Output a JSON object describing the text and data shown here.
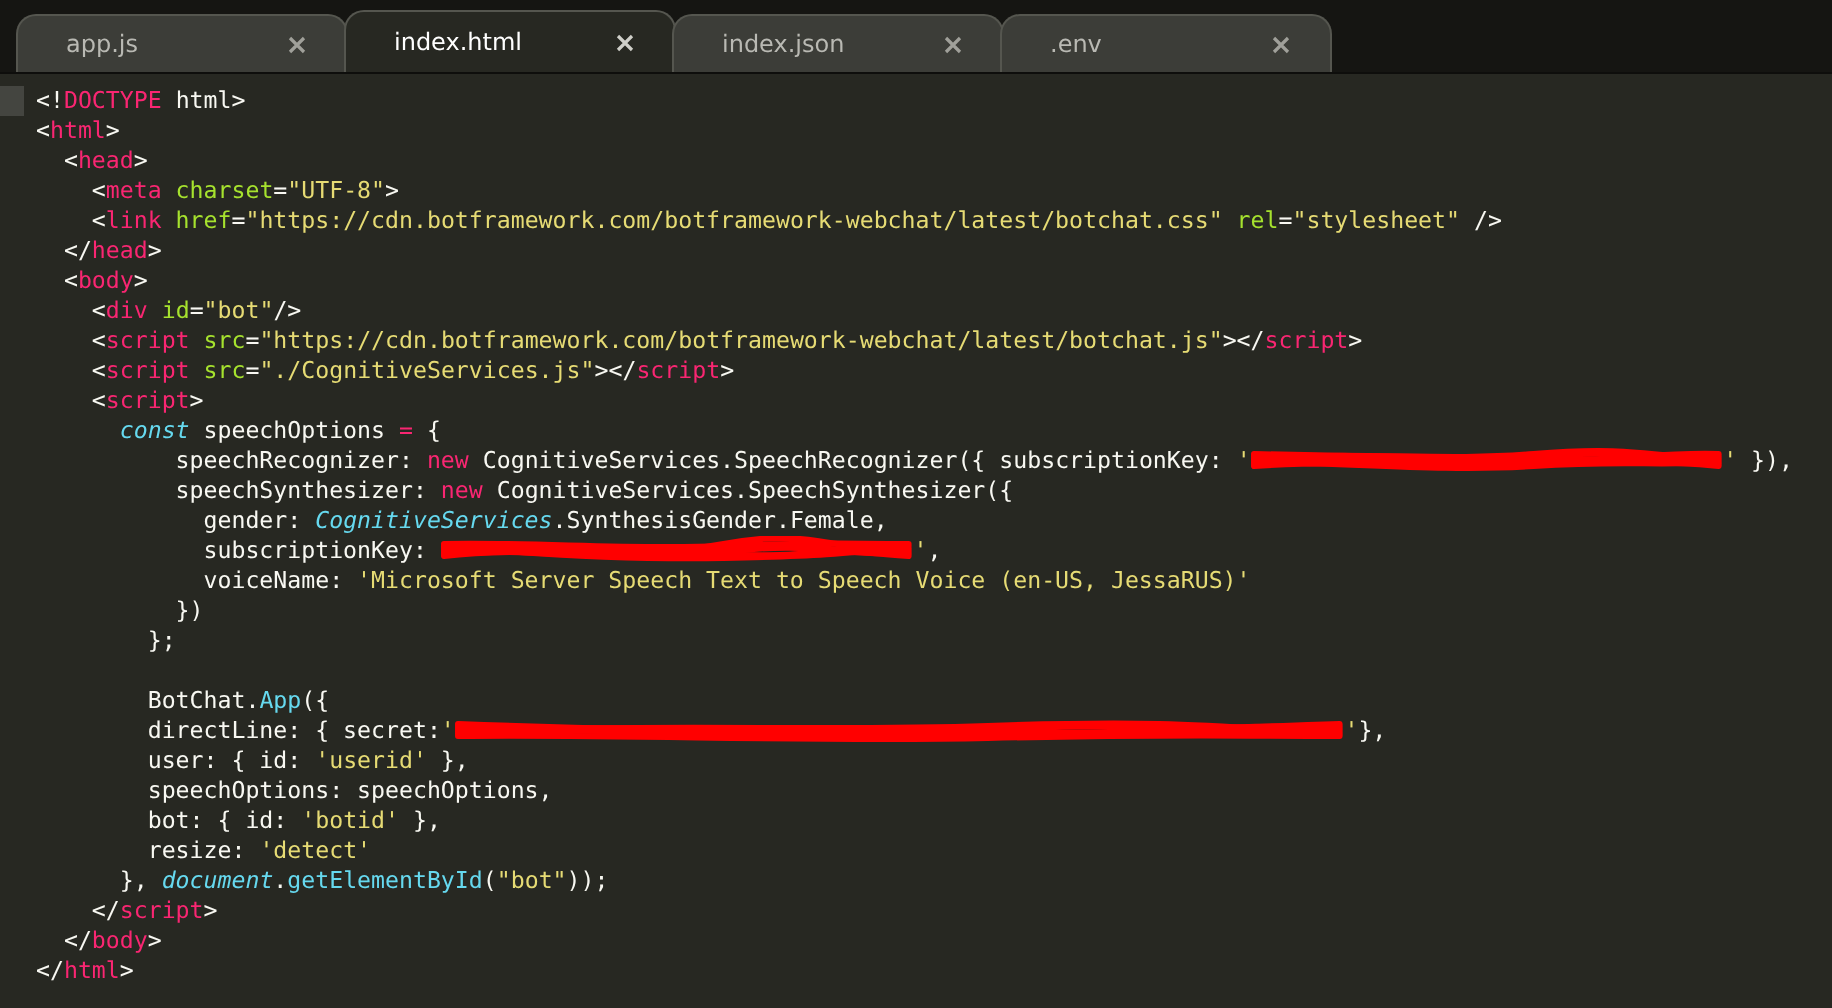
{
  "tabs": [
    {
      "label": "app.js",
      "selected": false
    },
    {
      "label": "index.html",
      "selected": true
    },
    {
      "label": "index.json",
      "selected": false
    },
    {
      "label": ".env",
      "selected": false
    }
  ],
  "editor": {
    "lines": [
      [
        {
          "kind": "p",
          "text": "<!"
        },
        {
          "kind": "tag",
          "text": "DOCTYPE"
        },
        {
          "kind": "p",
          "text": " html>"
        }
      ],
      [
        {
          "kind": "p",
          "text": "<"
        },
        {
          "kind": "tag",
          "text": "html"
        },
        {
          "kind": "p",
          "text": ">"
        }
      ],
      [
        {
          "kind": "p",
          "text": "  <"
        },
        {
          "kind": "tag",
          "text": "head"
        },
        {
          "kind": "p",
          "text": ">"
        }
      ],
      [
        {
          "kind": "p",
          "text": "    <"
        },
        {
          "kind": "tag",
          "text": "meta"
        },
        {
          "kind": "attr",
          "text": " charset"
        },
        {
          "kind": "p",
          "text": "="
        },
        {
          "kind": "str",
          "text": "\"UTF-8\""
        },
        {
          "kind": "p",
          "text": ">"
        }
      ],
      [
        {
          "kind": "p",
          "text": "    <"
        },
        {
          "kind": "tag",
          "text": "link"
        },
        {
          "kind": "attr",
          "text": " href"
        },
        {
          "kind": "p",
          "text": "="
        },
        {
          "kind": "str",
          "text": "\"https://cdn.botframework.com/botframework-webchat/latest/botchat.css\""
        },
        {
          "kind": "attr",
          "text": " rel"
        },
        {
          "kind": "p",
          "text": "="
        },
        {
          "kind": "str",
          "text": "\"stylesheet\""
        },
        {
          "kind": "p",
          "text": " />"
        }
      ],
      [
        {
          "kind": "p",
          "text": "  </"
        },
        {
          "kind": "tag",
          "text": "head"
        },
        {
          "kind": "p",
          "text": ">"
        }
      ],
      [
        {
          "kind": "p",
          "text": "  <"
        },
        {
          "kind": "tag",
          "text": "body"
        },
        {
          "kind": "p",
          "text": ">"
        }
      ],
      [
        {
          "kind": "p",
          "text": "    <"
        },
        {
          "kind": "tag",
          "text": "div"
        },
        {
          "kind": "attr",
          "text": " id"
        },
        {
          "kind": "p",
          "text": "="
        },
        {
          "kind": "str",
          "text": "\"bot\""
        },
        {
          "kind": "p",
          "text": "/>"
        }
      ],
      [
        {
          "kind": "p",
          "text": "    <"
        },
        {
          "kind": "tag",
          "text": "script"
        },
        {
          "kind": "attr",
          "text": " src"
        },
        {
          "kind": "p",
          "text": "="
        },
        {
          "kind": "str",
          "text": "\"https://cdn.botframework.com/botframework-webchat/latest/botchat.js\""
        },
        {
          "kind": "p",
          "text": "></"
        },
        {
          "kind": "tag",
          "text": "script"
        },
        {
          "kind": "p",
          "text": ">"
        }
      ],
      [
        {
          "kind": "p",
          "text": "    <"
        },
        {
          "kind": "tag",
          "text": "script"
        },
        {
          "kind": "attr",
          "text": " src"
        },
        {
          "kind": "p",
          "text": "="
        },
        {
          "kind": "str",
          "text": "\"./CognitiveServices.js\""
        },
        {
          "kind": "p",
          "text": "></"
        },
        {
          "kind": "tag",
          "text": "script"
        },
        {
          "kind": "p",
          "text": ">"
        }
      ],
      [
        {
          "kind": "p",
          "text": "    <"
        },
        {
          "kind": "tag",
          "text": "script"
        },
        {
          "kind": "p",
          "text": ">"
        }
      ],
      [
        {
          "kind": "st",
          "text": "      const"
        },
        {
          "kind": "p",
          "text": " speechOptions "
        },
        {
          "kind": "kw",
          "text": "="
        },
        {
          "kind": "p",
          "text": " {"
        }
      ],
      [
        {
          "kind": "p",
          "text": "          speechRecognizer: "
        },
        {
          "kind": "kw",
          "text": "new"
        },
        {
          "kind": "p",
          "text": " CognitiveServices.SpeechRecognizer({ subscriptionKey: "
        },
        {
          "kind": "str",
          "text": "'"
        },
        {
          "kind": "scribble"
        },
        {
          "kind": "str",
          "text": "'"
        },
        {
          "kind": "p",
          "text": " }),"
        }
      ],
      [
        {
          "kind": "p",
          "text": "          speechSynthesizer: "
        },
        {
          "kind": "kw",
          "text": "new"
        },
        {
          "kind": "p",
          "text": " CognitiveServices.SpeechSynthesizer({"
        }
      ],
      [
        {
          "kind": "p",
          "text": "            gender: "
        },
        {
          "kind": "cls",
          "text": "CognitiveServices"
        },
        {
          "kind": "p",
          "text": ".SynthesisGender.Female,"
        }
      ],
      [
        {
          "kind": "p",
          "text": "            subscriptionKey: "
        },
        {
          "kind": "scribble"
        },
        {
          "kind": "str",
          "text": "'"
        },
        {
          "kind": "p",
          "text": ","
        }
      ],
      [
        {
          "kind": "p",
          "text": "            voiceName: "
        },
        {
          "kind": "str",
          "text": "'Microsoft Server Speech Text to Speech Voice (en-US, JessaRUS)'"
        }
      ],
      [
        {
          "kind": "p",
          "text": "          })"
        }
      ],
      [
        {
          "kind": "p",
          "text": "        };"
        }
      ],
      [
        {
          "kind": "blank"
        }
      ],
      [
        {
          "kind": "p",
          "text": "        BotChat."
        },
        {
          "kind": "fn",
          "text": "App"
        },
        {
          "kind": "p",
          "text": "({"
        }
      ],
      [
        {
          "kind": "p",
          "text": "        directLine: { secret:"
        },
        {
          "kind": "str",
          "text": "'"
        },
        {
          "kind": "long-scribble"
        },
        {
          "kind": "str",
          "text": "'"
        },
        {
          "kind": "p",
          "text": "},"
        }
      ],
      [
        {
          "kind": "p",
          "text": "        user: { id: "
        },
        {
          "kind": "str",
          "text": "'userid'"
        },
        {
          "kind": "p",
          "text": " },"
        }
      ],
      [
        {
          "kind": "p",
          "text": "        speechOptions: speechOptions,"
        }
      ],
      [
        {
          "kind": "p",
          "text": "        bot: { id: "
        },
        {
          "kind": "str",
          "text": "'botid'"
        },
        {
          "kind": "p",
          "text": " },"
        }
      ],
      [
        {
          "kind": "p",
          "text": "        resize: "
        },
        {
          "kind": "str",
          "text": "'detect'"
        }
      ],
      [
        {
          "kind": "p",
          "text": "      }, "
        },
        {
          "kind": "cls",
          "text": "document"
        },
        {
          "kind": "p",
          "text": "."
        },
        {
          "kind": "fn",
          "text": "getElementById"
        },
        {
          "kind": "p",
          "text": "("
        },
        {
          "kind": "str",
          "text": "\"bot\""
        },
        {
          "kind": "p",
          "text": "));"
        }
      ],
      [
        {
          "kind": "p",
          "text": "    </"
        },
        {
          "kind": "tag",
          "text": "script"
        },
        {
          "kind": "p",
          "text": ">"
        }
      ],
      [
        {
          "kind": "p",
          "text": "  </"
        },
        {
          "kind": "tag",
          "text": "body"
        },
        {
          "kind": "p",
          "text": ">"
        }
      ],
      [
        {
          "kind": "p",
          "text": "</"
        },
        {
          "kind": "tag",
          "text": "html"
        },
        {
          "kind": "p",
          "text": ">"
        }
      ]
    ]
  }
}
